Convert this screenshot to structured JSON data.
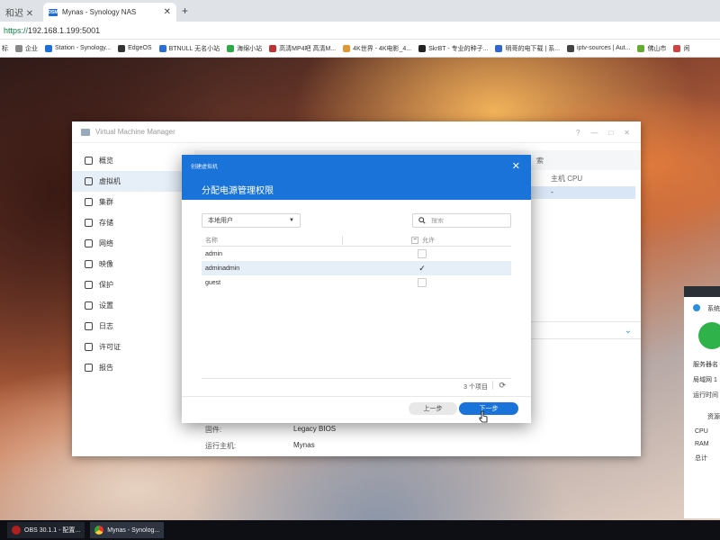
{
  "browser": {
    "left_tab_label": "和迟",
    "tab_title": "Mynas - Synology NAS",
    "tab_favicon": "DSM",
    "url_proto": "https://",
    "url_rest": "192.168.1.199:5001",
    "bookmarks": [
      "标",
      "企业",
      "Station - Synology...",
      "EdgeOS",
      "BTNULL 无名小站",
      "海绵小站",
      "高清MP4吧 高清M...",
      "4K世界 - 4K电影_4...",
      "SkrBT - 专业的种子...",
      "明哥的电下载 | 系...",
      "iptv-sources | Aut...",
      "佛山市",
      "闲"
    ]
  },
  "vmm": {
    "title": "Virtual Machine Manager",
    "controls": [
      "?",
      "—",
      "□",
      "✕"
    ],
    "sidebar": [
      {
        "label": "概览",
        "icon": "overview-icon"
      },
      {
        "label": "虚拟机",
        "icon": "vm-icon"
      },
      {
        "label": "集群",
        "icon": "cluster-icon"
      },
      {
        "label": "存储",
        "icon": "storage-icon"
      },
      {
        "label": "网络",
        "icon": "network-icon"
      },
      {
        "label": "映像",
        "icon": "image-icon"
      },
      {
        "label": "保护",
        "icon": "protect-icon"
      },
      {
        "label": "设置",
        "icon": "settings-icon"
      },
      {
        "label": "日志",
        "icon": "log-icon"
      },
      {
        "label": "许可证",
        "icon": "license-icon"
      },
      {
        "label": "报告",
        "icon": "report-icon"
      }
    ],
    "columns": {
      "search_hint": "索",
      "host_cpu": "主机 CPU"
    },
    "row_value": "-",
    "details": {
      "firmware_label": "固件:",
      "firmware_value": "Legacy BIOS",
      "host_label": "运行主机:",
      "host_value": "Mynas"
    }
  },
  "modal": {
    "small_title": "创建虚拟机",
    "title": "分配电源管理权限",
    "select_value": "本地用户",
    "search_placeholder": "搜索",
    "col_name": "名称",
    "col_allow": "允许",
    "users": [
      {
        "name": "admin",
        "checked": false
      },
      {
        "name": "adminadmin",
        "checked": true
      },
      {
        "name": "guest",
        "checked": false
      }
    ],
    "count": "3 个项目",
    "prev": "上一步",
    "next": "下一步"
  },
  "widget": {
    "title": "系统",
    "line1": "服务器名",
    "line2": "局域网 1",
    "line3": "运行时间",
    "res_title": "资源",
    "cpu": "CPU",
    "ram": "RAM",
    "total": "总计"
  },
  "taskbar": {
    "obs": "OBS 30.1.1 - 配置...",
    "chrome": "Mynas - Synolog..."
  }
}
